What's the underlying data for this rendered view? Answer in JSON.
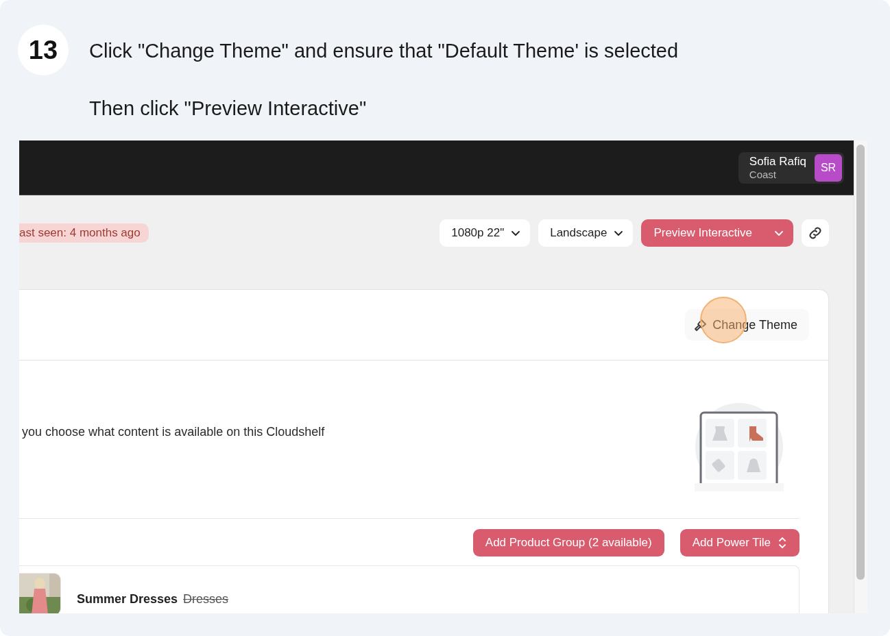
{
  "step": {
    "number": "13",
    "lines": [
      "Click \"Change Theme\" and ensure that \"Default Theme' is selected",
      "Then click \"Preview Interactive\""
    ]
  },
  "screenshot": {
    "user": {
      "name": "Sofia Rafiq",
      "org": "Coast",
      "initials": "SR",
      "color": "#b84cc8"
    },
    "status_badge": "ast seen: 4 months ago",
    "selects": [
      "1080p 22\"",
      "Landscape"
    ],
    "preview_button": "Preview Interactive",
    "theme_button": "Change Theme",
    "description": "you choose what content is available on this Cloudshelf",
    "buttons": [
      {
        "label": "Add Product Group (2 available)",
        "kind": "plain"
      },
      {
        "label": "Add Power Tile",
        "kind": "updown"
      }
    ],
    "items": [
      {
        "title": "Summer Dresses",
        "old_title": "Dresses"
      }
    ]
  }
}
